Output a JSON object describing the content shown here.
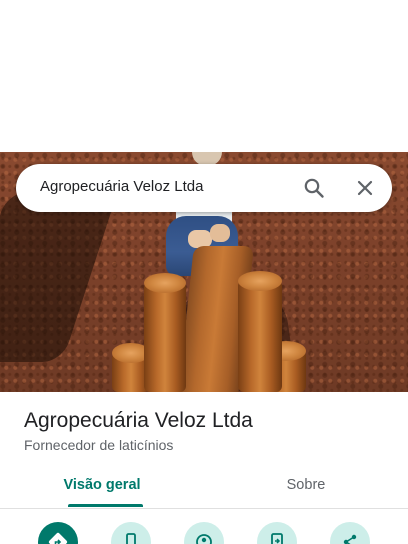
{
  "search": {
    "query": "Agropecuária Veloz Ltda"
  },
  "place": {
    "title": "Agropecuária Veloz Ltda",
    "category": "Fornecedor de laticínios"
  },
  "tabs": [
    {
      "label": "Visão geral",
      "active": true
    },
    {
      "label": "Sobre",
      "active": false
    }
  ],
  "actions": [
    {
      "icon": "directions-icon"
    },
    {
      "icon": "phone-icon"
    },
    {
      "icon": "nearby-icon"
    },
    {
      "icon": "send-to-phone-icon"
    },
    {
      "icon": "share-icon"
    }
  ],
  "colors": {
    "accent": "#00796b",
    "action_bg": "#cdeee9"
  }
}
